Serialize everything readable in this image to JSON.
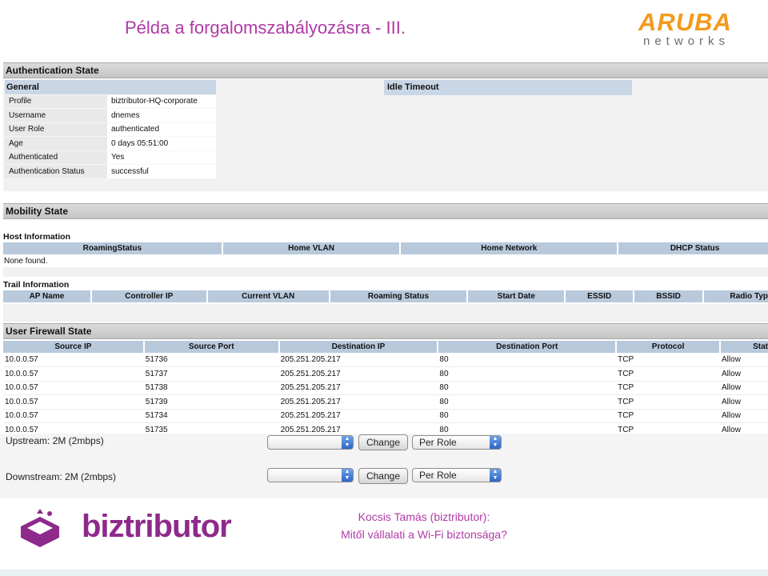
{
  "slide": {
    "title": "Példa a forgalomszabályozásra - III.",
    "aruba_word": "ARUBA",
    "aruba_sub": "networks"
  },
  "auth": {
    "title": "Authentication State",
    "general_label": "General",
    "idle_label": "Idle Timeout",
    "rows": [
      {
        "key": "Profile",
        "value": "biztributor-HQ-corporate"
      },
      {
        "key": "Username",
        "value": "dnemes"
      },
      {
        "key": "User Role",
        "value": "authenticated"
      },
      {
        "key": "Age",
        "value": "0 days 05:51:00"
      },
      {
        "key": "Authenticated",
        "value": "Yes"
      },
      {
        "key": "Authentication Status",
        "value": "successful"
      }
    ]
  },
  "mobility": {
    "title": "Mobility State",
    "host_info": "Host Information",
    "host_columns": [
      "RoamingStatus",
      "Home VLAN",
      "Home Network",
      "DHCP Status"
    ],
    "none_found": "None found.",
    "trail_info": "Trail Information",
    "trail_columns": [
      "AP Name",
      "Controller IP",
      "Current VLAN",
      "Roaming Status",
      "Start Date",
      "ESSID",
      "BSSID",
      "Radio Typ"
    ]
  },
  "firewall": {
    "title": "User Firewall State",
    "columns": [
      "Source IP",
      "Source Port",
      "Destination IP",
      "Destination Port",
      "Protocol",
      "Stat"
    ],
    "rows": [
      [
        "10.0.0.57",
        "51736",
        "205.251.205.217",
        "80",
        "TCP",
        "Allow"
      ],
      [
        "10.0.0.57",
        "51737",
        "205.251.205.217",
        "80",
        "TCP",
        "Allow"
      ],
      [
        "10.0.0.57",
        "51738",
        "205.251.205.217",
        "80",
        "TCP",
        "Allow"
      ],
      [
        "10.0.0.57",
        "51739",
        "205.251.205.217",
        "80",
        "TCP",
        "Allow"
      ],
      [
        "10.0.0.57",
        "51734",
        "205.251.205.217",
        "80",
        "TCP",
        "Allow"
      ],
      [
        "10.0.0.57",
        "51735",
        "205.251.205.217",
        "80",
        "TCP",
        "Allow"
      ]
    ]
  },
  "bandwidth": {
    "upstream_label": "Upstream: 2M (2mbps)",
    "downstream_label": "Downstream: 2M (2mbps)",
    "change_label": "Change",
    "role_label": "Per Role"
  },
  "footer": {
    "brand": "biztributor",
    "author_line1": "Kocsis Tamás (biztributor):",
    "author_line2": "Mitől vállalati a Wi-Fi biztonsága?"
  },
  "colors": {
    "title_purple": "#b03aa6",
    "aruba_orange": "#f29a1e",
    "table_header_blue": "#b9c9dc"
  }
}
